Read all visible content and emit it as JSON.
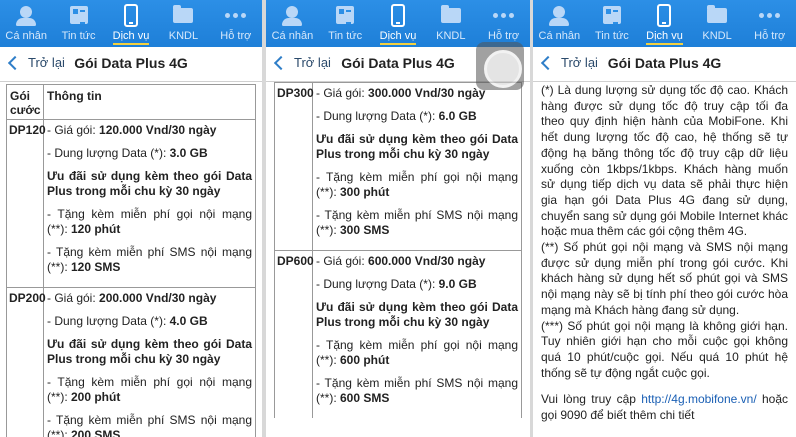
{
  "nav": {
    "items": [
      {
        "label": "Cá nhân",
        "icon": "person-icon"
      },
      {
        "label": "Tin tức",
        "icon": "news-icon"
      },
      {
        "label": "Dịch vụ",
        "icon": "phone-icon"
      },
      {
        "label": "KNDL",
        "icon": "folder-icon"
      },
      {
        "label": "Hỗ trợ",
        "icon": "more-dots-icon"
      }
    ],
    "active_index": 2
  },
  "header": {
    "back_label": "Trở lại",
    "title": "Gói Data Plus 4G"
  },
  "table": {
    "col_package": "Gói cước",
    "col_info": "Thông tin"
  },
  "packages": [
    {
      "code": "DP120",
      "price_label": "- Giá gói: ",
      "price": "120.000 Vnd/30 ngày",
      "data_label": "- Dung lượng Data (*): ",
      "data": "3.0 GB",
      "promo": "Ưu đãi sử dụng kèm theo gói Data Plus trong mỗi chu kỳ 30 ngày",
      "call_label": "- Tặng kèm miễn phí gọi nội mạng (**): ",
      "call": "120 phút",
      "sms_label": "- Tặng kèm miễn phí SMS nội mạng (**): ",
      "sms": "120 SMS"
    },
    {
      "code": "DP200",
      "price_label": "- Giá gói: ",
      "price": "200.000 Vnd/30 ngày",
      "data_label": "- Dung lượng Data (*): ",
      "data": "4.0 GB",
      "promo": "Ưu đãi sử dụng kèm theo gói Data Plus trong mỗi chu kỳ 30 ngày",
      "call_label": "- Tặng kèm miễn phí gọi nội mạng (**): ",
      "call": "200 phút",
      "sms_label": "- Tặng kèm miễn phí SMS nội mạng (**): ",
      "sms": "200 SMS"
    },
    {
      "code": "DP300",
      "price_label": "- Giá gói: ",
      "price": "300.000 Vnd/30 ngày",
      "data_label": "- Dung lượng Data (*): ",
      "data": "6.0 GB",
      "promo": "Ưu đãi sử dụng kèm theo gói Data Plus trong mỗi chu kỳ 30 ngày",
      "call_label": "- Tặng kèm miễn phí gọi nội mạng (**): ",
      "call": "300 phút",
      "sms_label": "- Tặng kèm miễn phí SMS nội mạng (**): ",
      "sms": "300 SMS"
    },
    {
      "code": "DP600",
      "price_label": "- Giá gói: ",
      "price": "600.000 Vnd/30 ngày",
      "data_label": "- Dung lượng Data (*): ",
      "data": "9.0 GB",
      "promo": "Ưu đãi sử dụng kèm theo gói Data Plus trong mỗi chu kỳ 30 ngày",
      "call_label": "- Tặng kèm miễn phí gọi nội mạng (**): ",
      "call": "600 phút",
      "sms_label": "- Tặng kèm miễn phí SMS nội mạng (**): ",
      "sms": "600 SMS"
    }
  ],
  "notes": {
    "note1": "(*) Là dung lượng sử dụng tốc độ cao. Khách hàng được sử dụng tốc độ truy cập tối đa theo quy định hiện hành của MobiFone. Khi hết dung lượng tốc độ cao, hệ thống sẽ tự động hạ băng thông tốc độ truy cập dữ liệu xuống còn 1kbps/1kbps. Khách hàng muốn sử dụng tiếp dịch vụ data sẽ phải thực hiện gia hạn gói Data Plus 4G đang sử dụng, chuyển sang sử dụng gói Mobile Internet khác hoặc mua thêm các gói cộng thêm 4G.",
    "note2": "(**) Số phút gọi nội mạng và SMS nội mạng được sử dụng miễn phí trong gói cước. Khi khách hàng sử dụng hết số phút gọi và SMS nội mạng này sẽ bị tính phí theo gói cước hòa mạng mà Khách hàng đang sử dụng.",
    "note3": "(***) Số phút gọi nội mạng là không giới hạn. Tuy nhiên giới hạn cho mỗi cuộc gọi không quá 10 phút/cuộc gọi. Nếu quá 10 phút hệ thống sẽ tự động ngắt cuộc gọi.",
    "visit_prefix": "Vui lòng truy cập ",
    "visit_link": "http://4g.mobifone.vn/",
    "visit_suffix": " hoặc gọi 9090 để biết thêm chi tiết"
  },
  "colors": {
    "nav_bg": "#2c8fe6",
    "active_underline": "#f4d03f",
    "link": "#1a5fb4"
  }
}
